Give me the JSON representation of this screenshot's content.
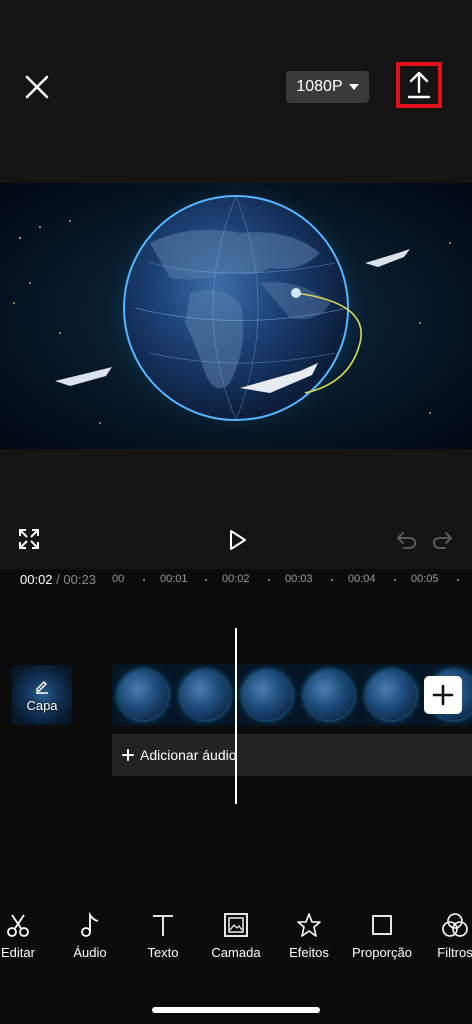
{
  "header": {
    "resolution_label": "1080P",
    "close_icon": "close-icon",
    "export_icon": "upload-icon",
    "export_highlight_color": "#e0101a"
  },
  "player": {
    "current_time": "00:02",
    "separator": "/",
    "total_time": "00:23",
    "fullscreen_icon": "fullscreen-icon",
    "play_icon": "play-icon",
    "undo_icon": "undo-icon",
    "redo_icon": "redo-icon"
  },
  "ruler": {
    "ticks": [
      "00",
      "00:01",
      "00:02",
      "00:03",
      "00:04",
      "00:05"
    ]
  },
  "timeline": {
    "cover_label": "Capa",
    "add_audio_label": "Adicionar áudio",
    "add_clip_icon": "plus-icon"
  },
  "toolbar": {
    "items": [
      {
        "label": "Editar",
        "icon": "scissors-icon"
      },
      {
        "label": "Áudio",
        "icon": "music-note-icon"
      },
      {
        "label": "Texto",
        "icon": "text-icon"
      },
      {
        "label": "Camada",
        "icon": "layer-icon"
      },
      {
        "label": "Efeitos",
        "icon": "star-icon"
      },
      {
        "label": "Proporção",
        "icon": "square-icon"
      },
      {
        "label": "Filtros",
        "icon": "filters-icon"
      }
    ]
  }
}
